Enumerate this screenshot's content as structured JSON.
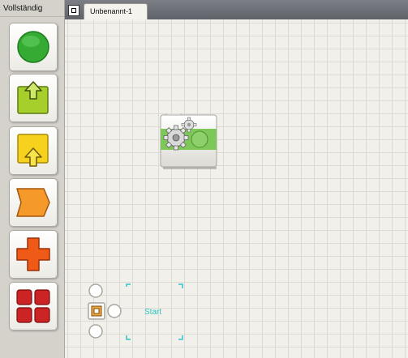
{
  "palette": {
    "title": "Vollständig",
    "items": [
      {
        "icon": "green-circle-icon",
        "color": "#2fa52f"
      },
      {
        "icon": "green-arrow-up-icon",
        "color": "#9ccc2a"
      },
      {
        "icon": "yellow-arrow-up-icon",
        "color": "#f3d11f"
      },
      {
        "icon": "orange-chevron-icon",
        "color": "#f08a1c"
      },
      {
        "icon": "orange-cross-icon",
        "color": "#ee5a16"
      },
      {
        "icon": "red-grid-icon",
        "color": "#c82222"
      }
    ]
  },
  "tabs": [
    {
      "label": "Unbenannt-1"
    }
  ],
  "canvas": {
    "block": {
      "icon": "gear-block-icon",
      "accent": "#7ec85a"
    },
    "start_label": "Start",
    "start_accent": "#2ec4c4"
  }
}
